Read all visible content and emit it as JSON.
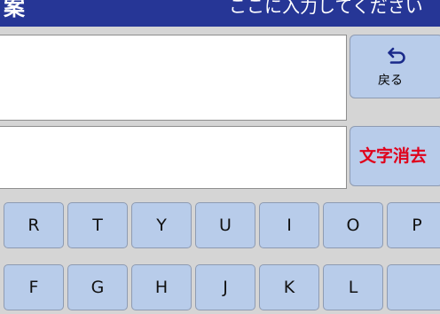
{
  "header": {
    "title": "案",
    "info": "ここに入力してください"
  },
  "buttons": {
    "back_label": "戻る",
    "clear_label": "文字消去"
  },
  "icons": {
    "back": "return-arrow-icon"
  },
  "colors": {
    "title_bar": "#263696",
    "key_bg": "#b8ccea",
    "clear_text": "#e0001a",
    "background": "#d5d5d5"
  },
  "keyboard": {
    "row1": [
      "R",
      "T",
      "Y",
      "U",
      "I",
      "O",
      "P"
    ],
    "row2": [
      "F",
      "G",
      "H",
      "J",
      "K",
      "L",
      ""
    ]
  }
}
